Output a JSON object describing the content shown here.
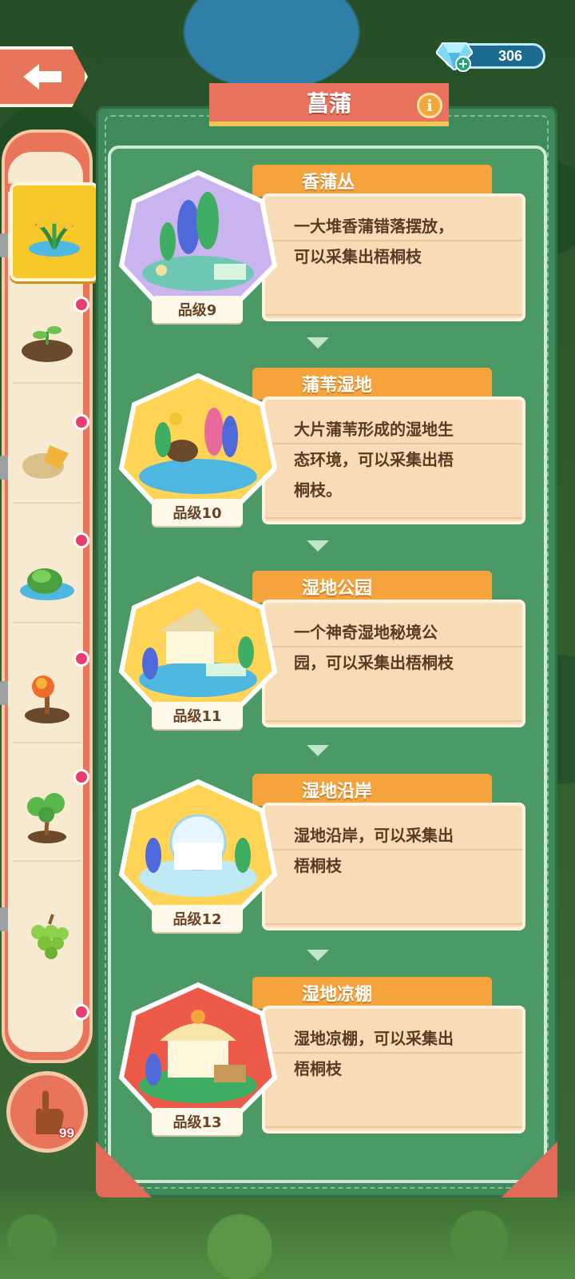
{
  "header": {
    "title": "菖蒲",
    "gem_count": "306"
  },
  "icons": {
    "back": "back-arrow-icon",
    "gem": "diamond-gem-icon",
    "info": "info-icon",
    "hint": "pointing-hand-icon"
  },
  "hint": {
    "count": "99"
  },
  "sidebar": {
    "items": [
      {
        "name": "calamus-plant",
        "selected": true
      },
      {
        "name": "sprout-mound",
        "selected": false,
        "has_dot": true
      },
      {
        "name": "leaf-on-rock",
        "selected": false,
        "has_dot": true
      },
      {
        "name": "mossy-pond",
        "selected": false,
        "has_dot": true
      },
      {
        "name": "orange-flower-stump",
        "selected": false,
        "has_dot": true
      },
      {
        "name": "bonsai-tree",
        "selected": false,
        "has_dot": true
      },
      {
        "name": "grapes",
        "selected": false,
        "has_dot": true
      }
    ]
  },
  "cards": [
    {
      "name": "香蒲丛",
      "desc_l1": "一大堆香蒲错落摆放，",
      "desc_l2": "可以采集出梧桐枝",
      "desc_l3": "",
      "grade": "品级9",
      "bg": "#c9b4f0"
    },
    {
      "name": "蒲苇湿地",
      "desc_l1": "大片蒲苇形成的湿地生",
      "desc_l2": "态环境，可以采集出梧",
      "desc_l3": "桐枝。",
      "grade": "品级10",
      "bg": "#ffd457"
    },
    {
      "name": "湿地公园",
      "desc_l1": "一个神奇湿地秘境公",
      "desc_l2": "园，可以采集出梧桐枝",
      "desc_l3": "",
      "grade": "品级11",
      "bg": "#ffd457"
    },
    {
      "name": "湿地沿岸",
      "desc_l1": "湿地沿岸，可以采集出",
      "desc_l2": "梧桐枝",
      "desc_l3": "",
      "grade": "品级12",
      "bg": "#ffd457"
    },
    {
      "name": "湿地凉棚",
      "desc_l1": "湿地凉棚，可以采集出",
      "desc_l2": "梧桐枝",
      "desc_l3": "",
      "grade": "品级13",
      "bg": "#ee5a4a"
    }
  ],
  "colors": {
    "panel_green": "#3f8a5a",
    "banner_red": "#e8725b",
    "name_orange": "#f5a33c",
    "desc_bg": "#f8dcb8",
    "notification_dot": "#e83d6d"
  }
}
